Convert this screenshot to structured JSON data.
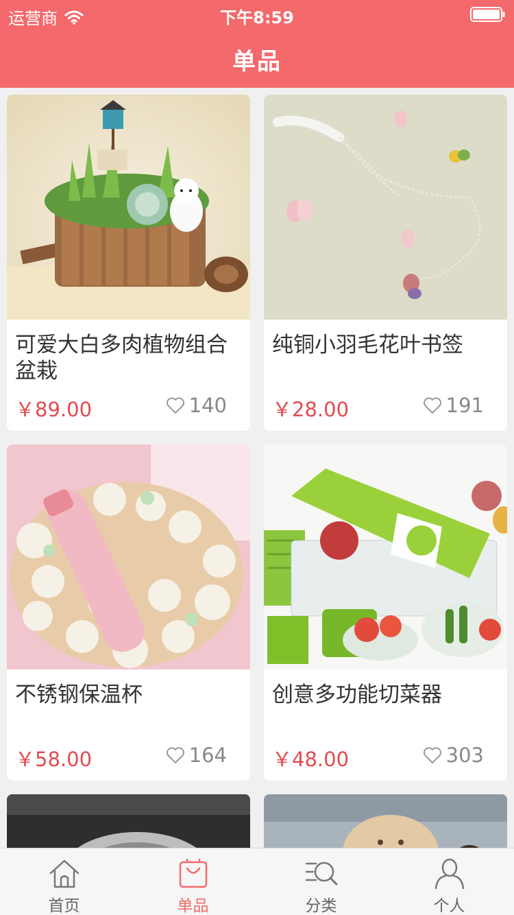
{
  "status_bar": {
    "carrier": "运营商",
    "time": "下午8:59"
  },
  "header": {
    "title": "单品"
  },
  "products": [
    {
      "name": "可爱大白多肉植物组合盆栽",
      "price": "￥89.00",
      "likes": "140"
    },
    {
      "name": "纯铜小羽毛花叶书签",
      "price": "￥28.00",
      "likes": "191"
    },
    {
      "name": "不锈钢保温杯",
      "price": "￥58.00",
      "likes": "164"
    },
    {
      "name": "创意多功能切菜器",
      "price": "￥48.00",
      "likes": "303"
    }
  ],
  "tabs": [
    {
      "label": "首页",
      "icon": "home-icon"
    },
    {
      "label": "单品",
      "icon": "bag-icon"
    },
    {
      "label": "分类",
      "icon": "category-search-icon"
    },
    {
      "label": "个人",
      "icon": "person-icon"
    }
  ],
  "colors": {
    "brand": "#f4696b",
    "price": "#e24b4f",
    "background": "#f0f0f0"
  }
}
